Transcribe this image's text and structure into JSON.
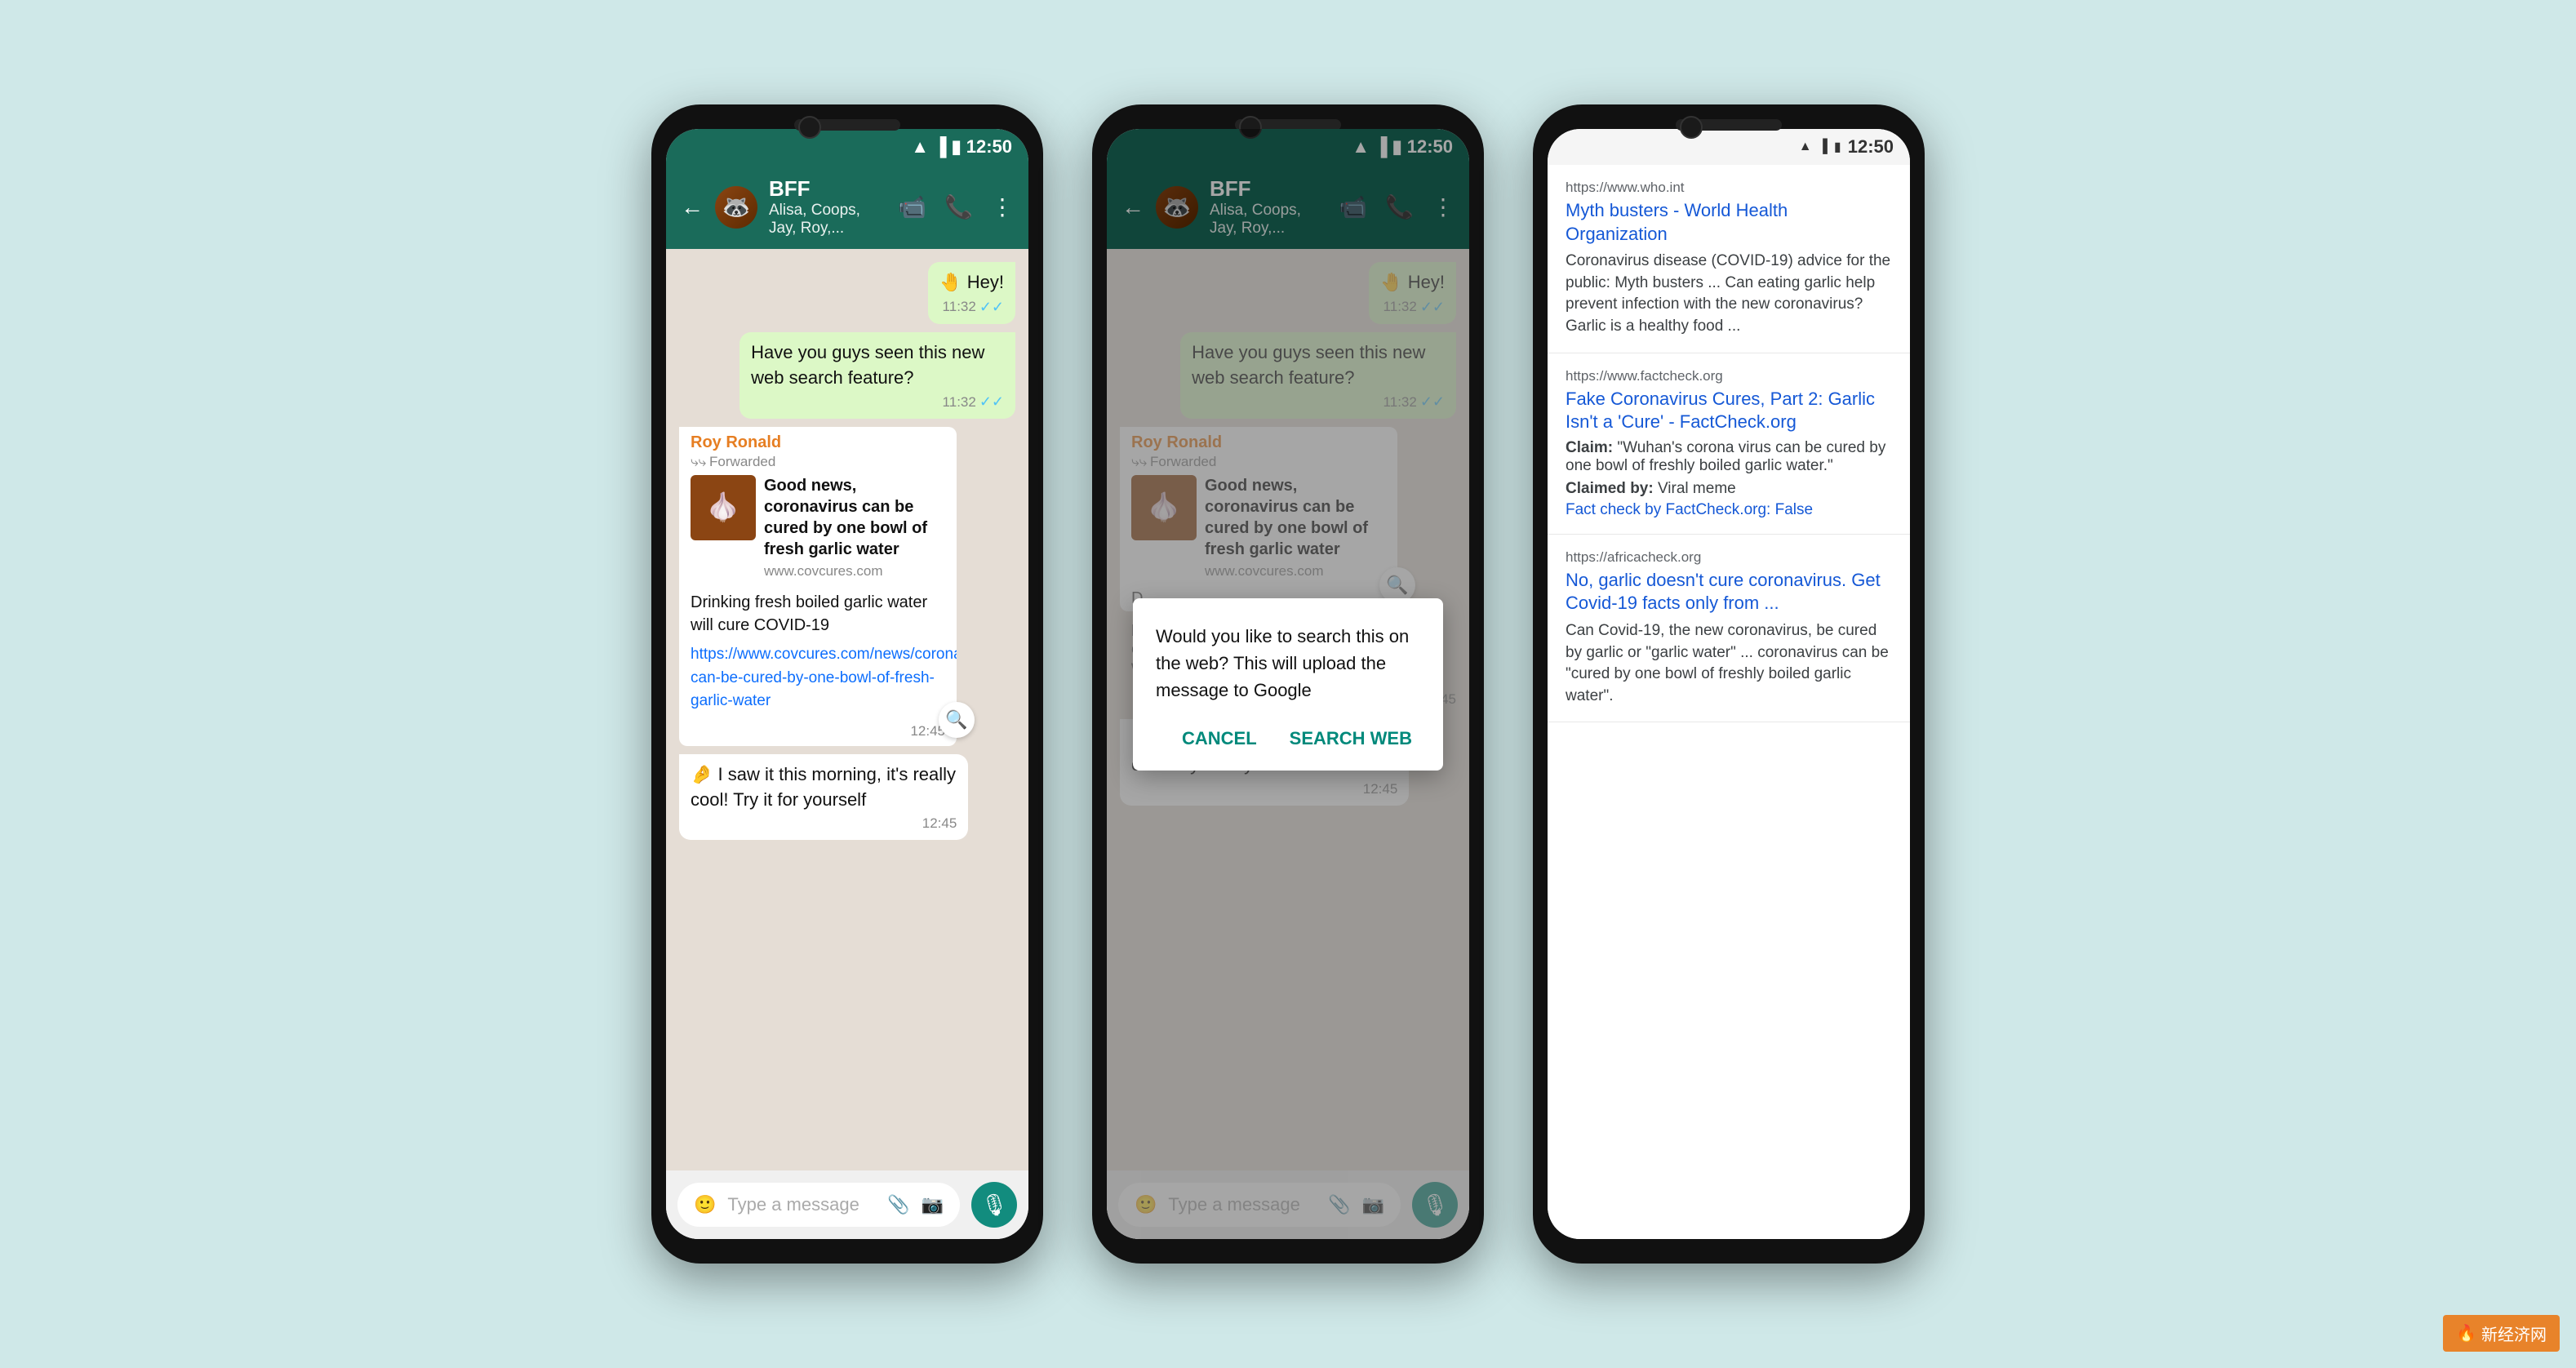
{
  "background": "#cfe8e8",
  "watermark": "新经济网",
  "phone1": {
    "status_time": "12:50",
    "header": {
      "name": "BFF",
      "members": "Alisa, Coops, Jay, Roy,..."
    },
    "messages": [
      {
        "type": "out",
        "text": "🤚 Hey!",
        "time": "11:32",
        "ticks": true
      },
      {
        "type": "out",
        "text": "Have you guys seen this new web search feature?",
        "time": "11:32",
        "ticks": true
      },
      {
        "type": "forward_card",
        "sender": "Roy Ronald",
        "label": "Forwarded",
        "thumb_emoji": "🧄",
        "title": "Good news, coronavirus can be cured by one bowl of fresh garlic water",
        "url": "www.covcures.com",
        "desc": "Drinking fresh boiled garlic water will cure COVID-19",
        "link": "https://www.covcures.com/news/coronavirus-can-be-cured-by-one-bowl-of-fresh-garlic-water",
        "time": "12:45"
      },
      {
        "type": "in",
        "text": "🤌 I saw it this morning, it's really cool! Try it for yourself",
        "time": "12:45"
      }
    ],
    "input_placeholder": "Type a message"
  },
  "phone2": {
    "status_time": "12:50",
    "header": {
      "name": "BFF",
      "members": "Alisa, Coops, Jay, Roy,..."
    },
    "dialog": {
      "text": "Would you like to search this on the web? This will upload the message to Google",
      "cancel": "CANCEL",
      "search": "SEARCH WEB"
    },
    "input_placeholder": "Type a message"
  },
  "phone3": {
    "status_time": "12:50",
    "results": [
      {
        "url": "https://www.who.int",
        "title": "Myth busters - World Health Organization",
        "snippet": "Coronavirus disease (COVID-19) advice for the public: Myth busters ... Can eating garlic help prevent infection with the new coronavirus? Garlic is a healthy food ..."
      },
      {
        "url": "https://www.factcheck.org",
        "title": "Fake Coronavirus Cures, Part 2: Garlic Isn't a 'Cure' - FactCheck.org",
        "claim": "\"Wuhan's corona virus can be cured by one bowl of freshly boiled garlic water.\"",
        "claimed_by": "Viral meme",
        "fact_check": "Fact check by FactCheck.org: False"
      },
      {
        "url": "https://africacheck.org",
        "title": "No, garlic doesn't cure coronavirus. Get Covid-19 facts only from ...",
        "snippet": "Can Covid-19, the new coronavirus, be cured by garlic or \"garlic water\" ... coronavirus can be \"cured by one bowl of freshly boiled garlic water\"."
      }
    ]
  }
}
